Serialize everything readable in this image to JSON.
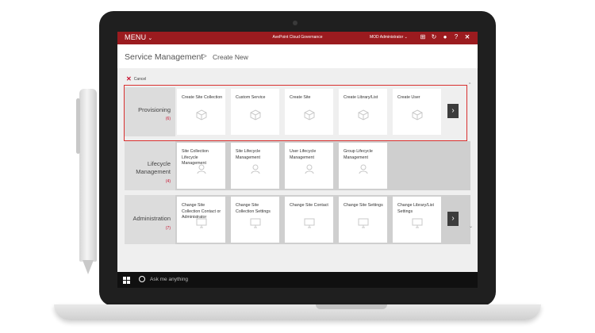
{
  "topbar": {
    "menu_label": "MENU",
    "brand": "AvePoint Cloud Governance",
    "user": "MOD Administrator",
    "accent": "#9b1b1f"
  },
  "header": {
    "title": "Service Management",
    "separator": ">",
    "subtitle": "Create New"
  },
  "toolbar": {
    "cancel_label": "Cancel"
  },
  "rows": [
    {
      "name": "Provisioning",
      "count": "(6)",
      "tiles": [
        "Create Site Collection",
        "Custom Service",
        "Create Site",
        "Create Library/List",
        "Create User"
      ]
    },
    {
      "name": "Lifecycle Management",
      "count": "(4)",
      "tiles": [
        "Site Collection Lifecycle Management",
        "Site Lifecycle Management",
        "User Lifecycle Management",
        "Group Lifecycle Management"
      ]
    },
    {
      "name": "Administration",
      "count": "(7)",
      "tiles": [
        "Change Site Collection Contact or Administrator",
        "Change Site Collection Settings",
        "Change Site Contact",
        "Change Site Settings",
        "Change Library/List Settings"
      ]
    }
  ],
  "taskbar": {
    "search_placeholder": "Ask me anything"
  },
  "highlight_color": "#d9302f"
}
